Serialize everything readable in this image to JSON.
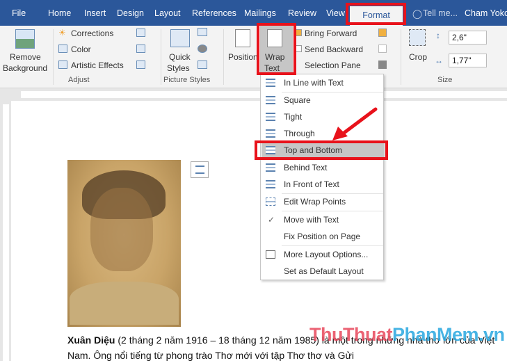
{
  "tabs": [
    "File",
    "Home",
    "Insert",
    "Design",
    "Layout",
    "References",
    "Mailings",
    "Review",
    "View",
    "Format"
  ],
  "tell_me": "Tell me...",
  "user": "Cham Yoko",
  "ribbon": {
    "remove_background": [
      "Remove",
      "Background"
    ],
    "corrections": "Corrections",
    "color": "Color",
    "artistic_effects": "Artistic Effects",
    "adjust_group": "Adjust",
    "quick_styles": [
      "Quick",
      "Styles"
    ],
    "picture_styles_group": "Picture Styles",
    "position": "Position",
    "wrap_text": [
      "Wrap",
      "Text"
    ],
    "bring_forward": "Bring Forward",
    "send_backward": "Send Backward",
    "selection_pane": "Selection Pane",
    "crop": "Crop",
    "height": "2,6\"",
    "width": "1,77\"",
    "size_group": "Size"
  },
  "wrap_menu": {
    "items": [
      "In Line with Text",
      "Square",
      "Tight",
      "Through",
      "Top and Bottom",
      "Behind Text",
      "In Front of Text",
      "Edit Wrap Points",
      "Move with Text",
      "Fix Position on Page",
      "More Layout Options...",
      "Set as Default Layout"
    ],
    "highlighted": "Top and Bottom",
    "checked": "Move with Text"
  },
  "document": {
    "bold_name": "Xuân Diệu",
    "text": " (2 tháng 2 năm 1916 – 18 tháng 12 năm 1985) là một trong những nhà thơ lớn của Việt Nam. Ông nổi tiếng từ phong trào Thơ mới với tập Thơ thơ và Gửi"
  },
  "watermark": {
    "part1": "ThuThuat",
    "part2": "PhanMem.vn",
    "color1": "#e8485c",
    "color2": "#29a8e0"
  },
  "colors": {
    "accent": "#2b579a",
    "highlight": "#e8121b"
  }
}
